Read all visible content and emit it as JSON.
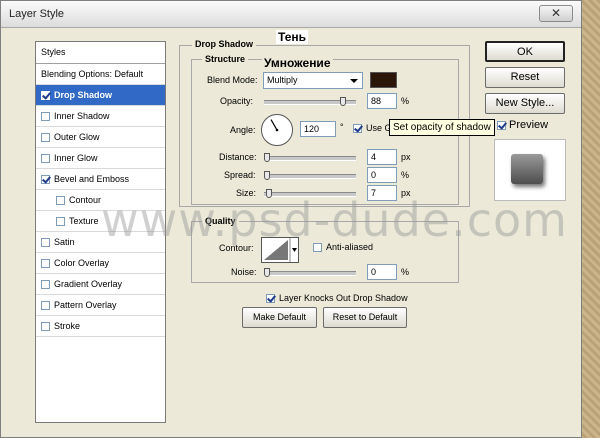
{
  "window": {
    "title": "Layer Style",
    "close_label": "✕"
  },
  "styles_panel": {
    "header": "Styles",
    "blending": "Blending Options: Default",
    "items": [
      {
        "label": "Drop Shadow",
        "checked": true,
        "selected": true
      },
      {
        "label": "Inner Shadow",
        "checked": false
      },
      {
        "label": "Outer Glow",
        "checked": false
      },
      {
        "label": "Inner Glow",
        "checked": false
      },
      {
        "label": "Bevel and Emboss",
        "checked": true
      },
      {
        "label": "Contour",
        "checked": false,
        "sub": true
      },
      {
        "label": "Texture",
        "checked": false,
        "sub": true
      },
      {
        "label": "Satin",
        "checked": false
      },
      {
        "label": "Color Overlay",
        "checked": false
      },
      {
        "label": "Gradient Overlay",
        "checked": false
      },
      {
        "label": "Pattern Overlay",
        "checked": false
      },
      {
        "label": "Stroke",
        "checked": false
      }
    ]
  },
  "drop_shadow": {
    "group_label": "Drop Shadow",
    "structure_label": "Structure",
    "blend_mode_label": "Blend Mode:",
    "blend_mode_value": "Multiply",
    "shadow_color": "#2a1508",
    "opacity_label": "Opacity:",
    "opacity_value": "88",
    "opacity_unit": "%",
    "angle_label": "Angle:",
    "angle_value": "120",
    "angle_unit": "°",
    "global_light_label": "Use G",
    "distance_label": "Distance:",
    "distance_value": "4",
    "distance_unit": "px",
    "spread_label": "Spread:",
    "spread_value": "0",
    "spread_unit": "%",
    "size_label": "Size:",
    "size_value": "7",
    "size_unit": "px",
    "quality_label": "Quality",
    "contour_label": "Contour:",
    "anti_aliased_label": "Anti-aliased",
    "noise_label": "Noise:",
    "noise_value": "0",
    "noise_unit": "%",
    "knockout_label": "Layer Knocks Out Drop Shadow",
    "make_default": "Make Default",
    "reset_default": "Reset to Default"
  },
  "right_buttons": {
    "ok": "OK",
    "reset": "Reset",
    "new_style": "New Style...",
    "preview": "Preview"
  },
  "tooltip": "Set opacity of shadow",
  "overlay": {
    "shadow_ru": "Тень",
    "multiply_ru": "Умножение"
  },
  "watermark": "www.psd-dude.com"
}
